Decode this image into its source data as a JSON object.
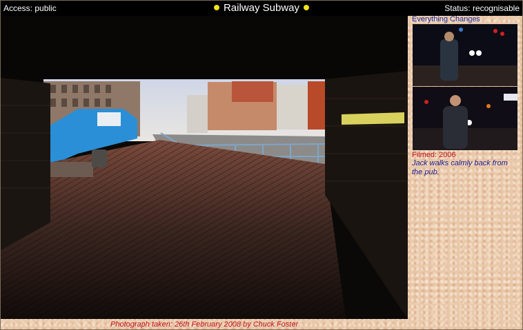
{
  "header": {
    "access": "Access: public",
    "title": "Railway Subway",
    "status": "Status: recognisable"
  },
  "photo": {
    "alt": "Railway Subway"
  },
  "sidebar": {
    "title": "Everything Changes",
    "filmed": "Filmed: 2006",
    "caption": "Jack walks calmly back from the pub."
  },
  "footer": {
    "credit": "Photograph taken: 26th February 2008 by Chuck Foster"
  },
  "colors": {
    "accent_dot": "#f2e21a",
    "link_blue": "#1a2aa0",
    "credit_red": "#c0121a"
  }
}
